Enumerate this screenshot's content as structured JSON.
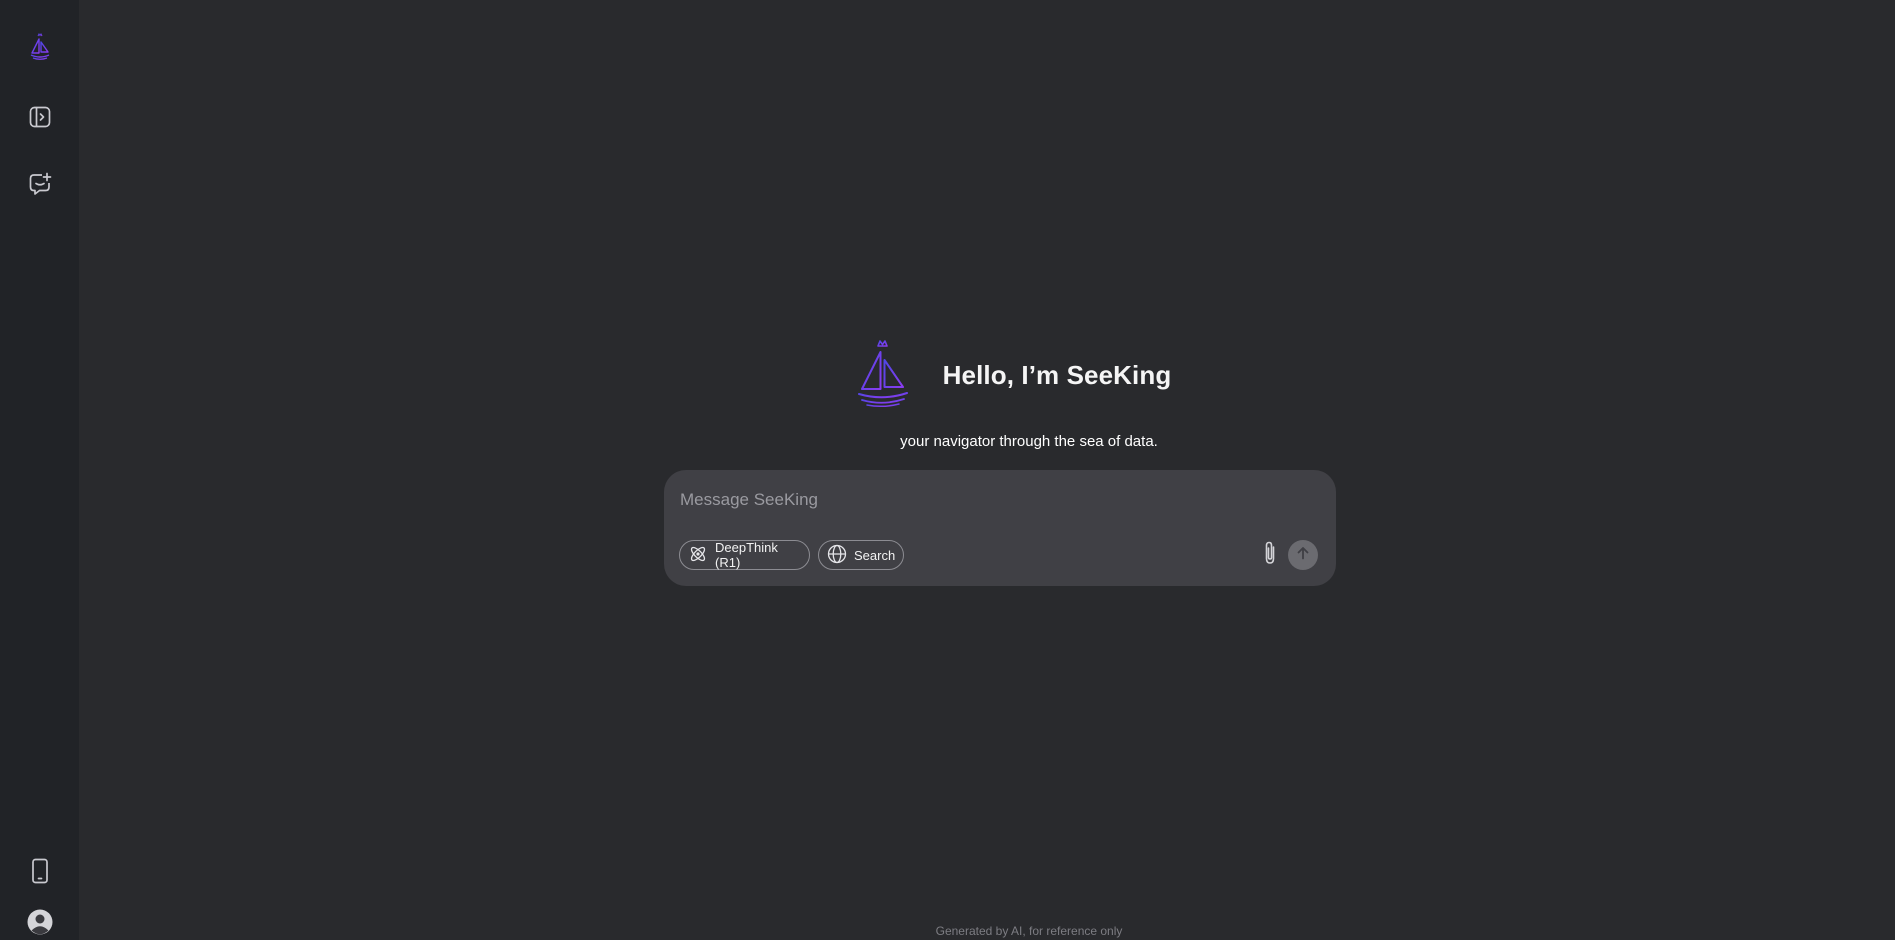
{
  "sidebar": {
    "icons": {
      "logo": "sailboat-logo-icon",
      "toggle": "sidebar-toggle-icon",
      "new_chat": "new-chat-icon",
      "mobile": "mobile-app-icon",
      "profile": "user-avatar-icon"
    }
  },
  "hero": {
    "title": "Hello, I’m SeeKing",
    "subtitle": "your navigator through the sea of data.",
    "logo_icon": "sailboat-crown-icon"
  },
  "composer": {
    "placeholder": "Message SeeKing",
    "value": "",
    "deepthink_label": "DeepThink (R1)",
    "search_label": "Search",
    "attach_icon": "paperclip-icon",
    "send_icon": "arrow-up-icon"
  },
  "footer": {
    "note": "Generated by AI, for reference only"
  },
  "colors": {
    "background": "#292a2d",
    "sidebar": "#212327",
    "composer": "#404045",
    "accent": "#5b4dff",
    "accent_secondary": "#8b3cf0"
  }
}
